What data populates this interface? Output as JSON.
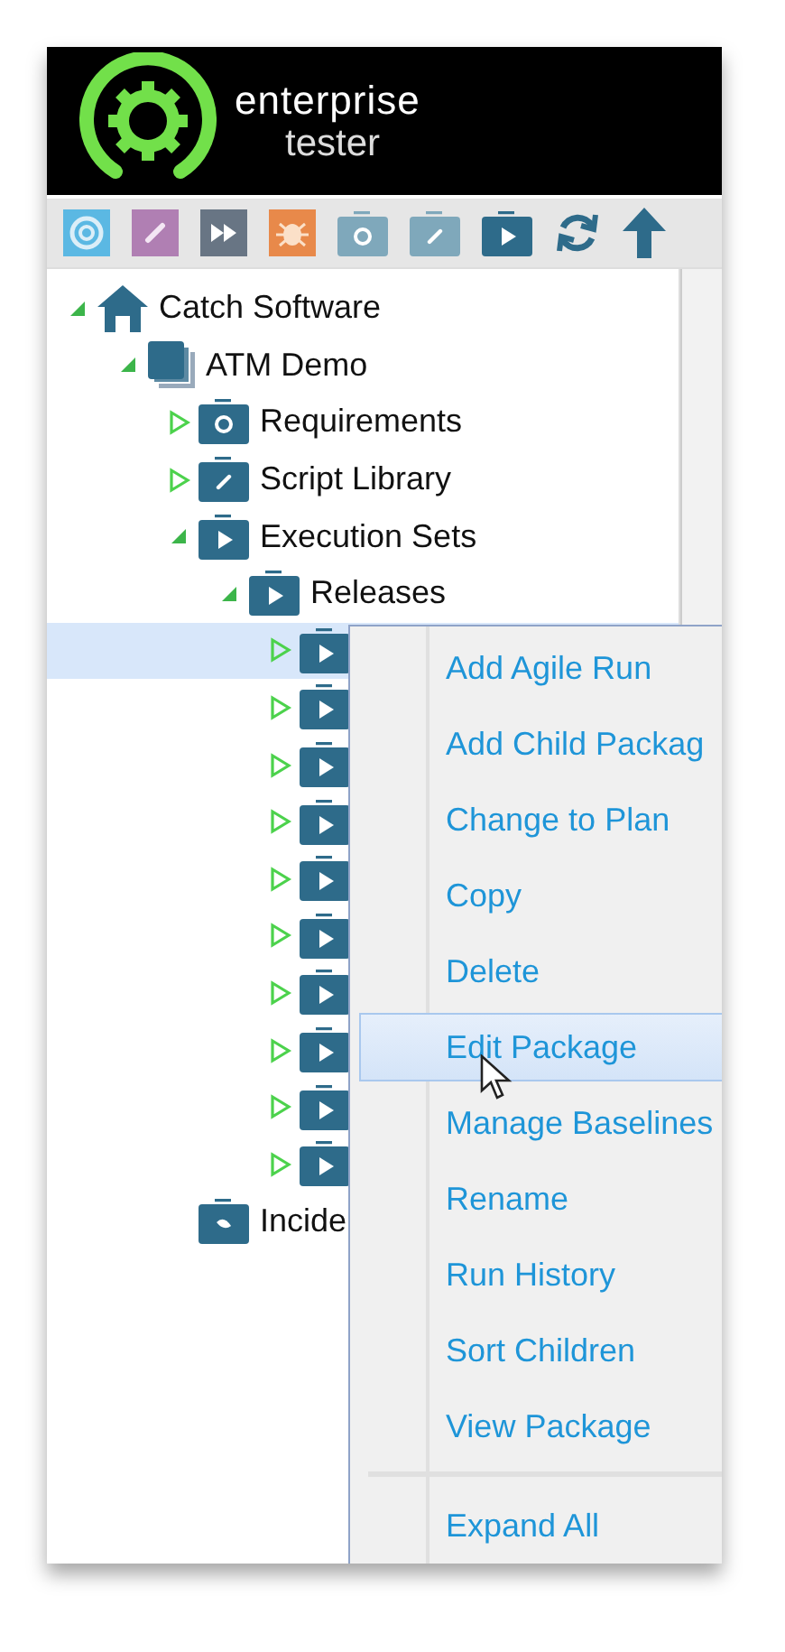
{
  "logo": {
    "line_1": "enterprise",
    "line_2": "tester"
  },
  "toolbar": [
    {
      "kind": "requirement"
    },
    {
      "kind": "script"
    },
    {
      "kind": "run"
    },
    {
      "kind": "incident"
    },
    {
      "kind": "requirements-folder"
    },
    {
      "kind": "scripts-folder"
    },
    {
      "kind": "execution-folder"
    },
    {
      "kind": "refresh"
    },
    {
      "kind": "up"
    }
  ],
  "tree": [
    {
      "label": "Catch Software",
      "kind": "home",
      "expanded": true,
      "selected": false,
      "children": [
        {
          "label": "ATM Demo",
          "kind": "project",
          "expanded": true,
          "selected": false,
          "children": [
            {
              "label": "Requirements",
              "kind": "requirements",
              "expanded": false,
              "selected": false
            },
            {
              "label": "Script Library",
              "kind": "scripts",
              "expanded": false,
              "selected": false
            },
            {
              "label": "Execution Sets",
              "kind": "execution",
              "expanded": true,
              "selected": false,
              "children": [
                {
                  "label": "Releases",
                  "kind": "execution",
                  "expanded": true,
                  "selected": false,
                  "children": [
                    {
                      "kind": "execution",
                      "expanded": false,
                      "selected": true
                    },
                    {
                      "kind": "execution",
                      "expanded": false,
                      "selected": false
                    },
                    {
                      "kind": "execution",
                      "expanded": false,
                      "selected": false
                    },
                    {
                      "kind": "execution",
                      "expanded": false,
                      "selected": false
                    },
                    {
                      "kind": "execution",
                      "expanded": false,
                      "selected": false
                    },
                    {
                      "kind": "execution",
                      "expanded": false,
                      "selected": false
                    },
                    {
                      "kind": "execution",
                      "expanded": false,
                      "selected": false
                    },
                    {
                      "kind": "execution",
                      "expanded": false,
                      "selected": false
                    },
                    {
                      "kind": "execution",
                      "expanded": false,
                      "selected": false
                    },
                    {
                      "kind": "execution",
                      "expanded": false,
                      "selected": false
                    }
                  ]
                }
              ]
            },
            {
              "label": "Incide",
              "kind": "incidents",
              "selected": false
            }
          ]
        }
      ]
    }
  ],
  "context_menu": {
    "sections": [
      {
        "items": [
          {
            "label": "Add Agile Run",
            "selected": false
          },
          {
            "label": "Add Child Packag",
            "selected": false
          },
          {
            "label": "Change to Plan",
            "selected": false
          },
          {
            "label": "Copy",
            "selected": false
          },
          {
            "label": "Delete",
            "selected": false
          },
          {
            "label": "Edit Package",
            "selected": true
          },
          {
            "label": "Manage Baselines",
            "selected": false
          },
          {
            "label": "Rename",
            "selected": false
          },
          {
            "label": "Run History",
            "selected": false
          },
          {
            "label": "Sort Children",
            "selected": false
          },
          {
            "label": "View Package",
            "selected": false
          }
        ]
      },
      {
        "items": [
          {
            "label": "Expand All",
            "selected": false
          }
        ]
      }
    ]
  }
}
